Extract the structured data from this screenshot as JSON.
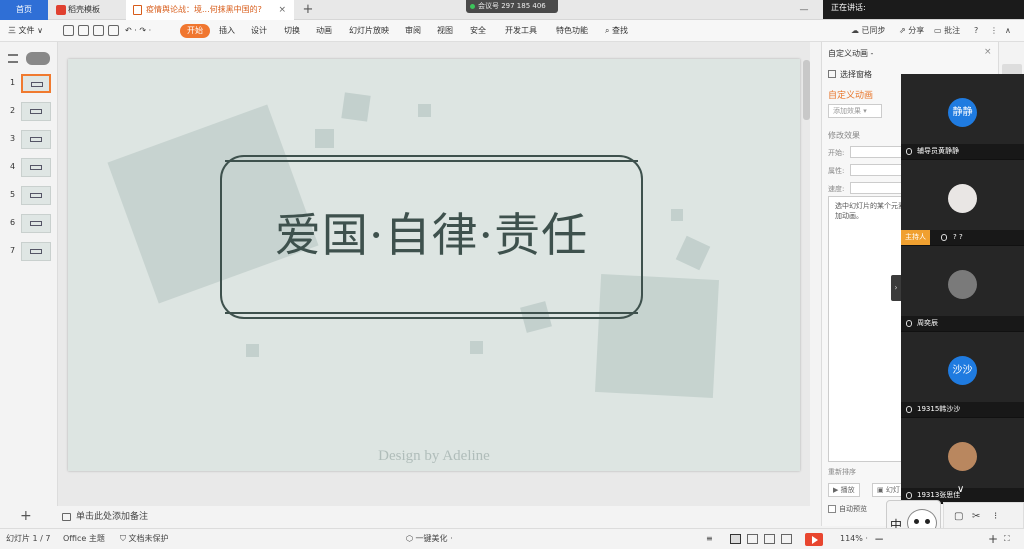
{
  "tabs": {
    "home": "首页",
    "template": "稻壳模板",
    "document": "疫情舆论战：境...何抹黑中国的?",
    "close": "×",
    "new": "+"
  },
  "meeting": {
    "id": "会议号 297 185 406",
    "speaking": "正在讲话:",
    "window_ctrl": "—"
  },
  "ribbon": {
    "file": "三 文件 ∨",
    "undo": "↶ · ↷ ·",
    "items": [
      "开始",
      "插入",
      "设计",
      "切换",
      "动画",
      "幻灯片放映",
      "审阅",
      "视图",
      "安全",
      "开发工具",
      "特色功能"
    ],
    "search": "查找",
    "synced": "已同步",
    "share": "分享",
    "comment": "批注",
    "help": "?",
    "more": "⋮",
    "collapse": "∧"
  },
  "thumbnails": {
    "numbers": [
      "1",
      "2",
      "3",
      "4",
      "5",
      "6",
      "7"
    ],
    "active": 1,
    "add": "+"
  },
  "slide": {
    "title": "爱国·自律·责任",
    "credit": "Design by Adeline"
  },
  "notes": {
    "placeholder": "单击此处添加备注"
  },
  "task_pane": {
    "title": "自定义动画 -",
    "close": "×",
    "select_pane": "选择窗格",
    "subtitle": "自定义动画",
    "add_effect": "添加效果 ▾",
    "modify_header": "修改效果",
    "start_label": "开始:",
    "property_label": "属性:",
    "speed_label": "速度:",
    "hint": "选中幻灯片的某个元素，然后单击\"添加效果\"添加动画。",
    "reorder": "重新排序",
    "play": "播放",
    "slideshow": "幻灯",
    "autopreview": "自动预览"
  },
  "participants": [
    {
      "avatar": "静静",
      "name": "辅导员黄静静",
      "style": "blue"
    },
    {
      "avatar": "",
      "name": "? ?",
      "style": "photo1",
      "host": "主持人"
    },
    {
      "avatar": "",
      "name": "周奕辰",
      "style": "photo2"
    },
    {
      "avatar": "沙沙",
      "name": "19315韩沙沙",
      "style": "blue"
    },
    {
      "avatar": "",
      "name": "19313张思佳",
      "style": "photo3"
    }
  ],
  "overlay": {
    "expand": "›",
    "scroll_down": "∨",
    "ime": "中"
  },
  "tools": {
    "folder": "▢",
    "cut": "✂",
    "other": "⁝"
  },
  "status": {
    "slide": "幻灯片 1 / 7",
    "theme": "Office 主题",
    "protect": "文档未保护",
    "beautify": "一键美化 ·",
    "zoom": "114% ·",
    "minus": "−",
    "plus": "+",
    "fit": "⛶"
  },
  "colors": {
    "accent": "#f0762f",
    "slide_bg": "#dde5e2",
    "slide_ink": "#3e514d",
    "tab_blue": "#2f6fd6"
  }
}
